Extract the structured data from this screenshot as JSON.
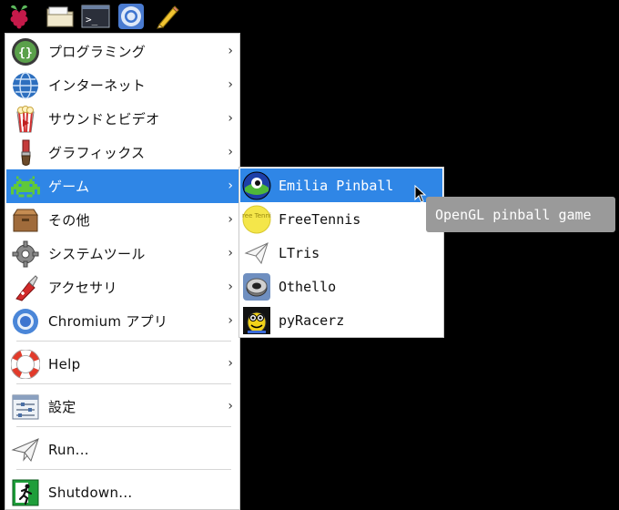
{
  "taskbar": {
    "icons": [
      "raspberry-menu-icon",
      "file-manager-icon",
      "terminal-icon",
      "chromium-icon",
      "text-editor-icon"
    ],
    "terminal_prompt": ">_"
  },
  "menu": {
    "items": [
      {
        "label": "プログラミング",
        "icon": "programming-icon",
        "submenu": true
      },
      {
        "label": "インターネット",
        "icon": "internet-globe-icon",
        "submenu": true
      },
      {
        "label": "サウンドとビデオ",
        "icon": "sound-video-icon",
        "submenu": true
      },
      {
        "label": "グラフィックス",
        "icon": "graphics-brush-icon",
        "submenu": true
      },
      {
        "label": "ゲーム",
        "icon": "games-invader-icon",
        "submenu": true,
        "active": true
      },
      {
        "label": "その他",
        "icon": "accessories-box-icon",
        "submenu": true
      },
      {
        "label": "システムツール",
        "icon": "system-tools-gear-icon",
        "submenu": true
      },
      {
        "label": "アクセサリ",
        "icon": "accessories-knife-icon",
        "submenu": true
      },
      {
        "label": "Chromium アプリ",
        "icon": "chromium-apps-icon",
        "submenu": true
      },
      {
        "label": "Help",
        "icon": "help-lifebuoy-icon",
        "submenu": true
      },
      {
        "label": "設定",
        "icon": "settings-icon",
        "submenu": true
      },
      {
        "label": "Run...",
        "icon": "run-paperplane-icon",
        "submenu": false
      },
      {
        "label": "Shutdown...",
        "icon": "shutdown-exit-icon",
        "submenu": false
      }
    ],
    "arrow": "›"
  },
  "games_submenu": {
    "items": [
      {
        "label": "Emilia Pinball",
        "icon": "emilia-pinball-icon",
        "active": true
      },
      {
        "label": "FreeTennis",
        "icon": "freetennis-ball-icon",
        "icon_text": "Free Tennis"
      },
      {
        "label": "LTris",
        "icon": "ltris-icon"
      },
      {
        "label": "Othello",
        "icon": "othello-icon"
      },
      {
        "label": "pyRacerz",
        "icon": "pyracerz-icon"
      }
    ]
  },
  "tooltip": {
    "text": "OpenGL pinball game"
  },
  "colors": {
    "highlight": "#2f86e6",
    "tooltip_bg": "#9a9a9a",
    "panel": "#000000"
  }
}
